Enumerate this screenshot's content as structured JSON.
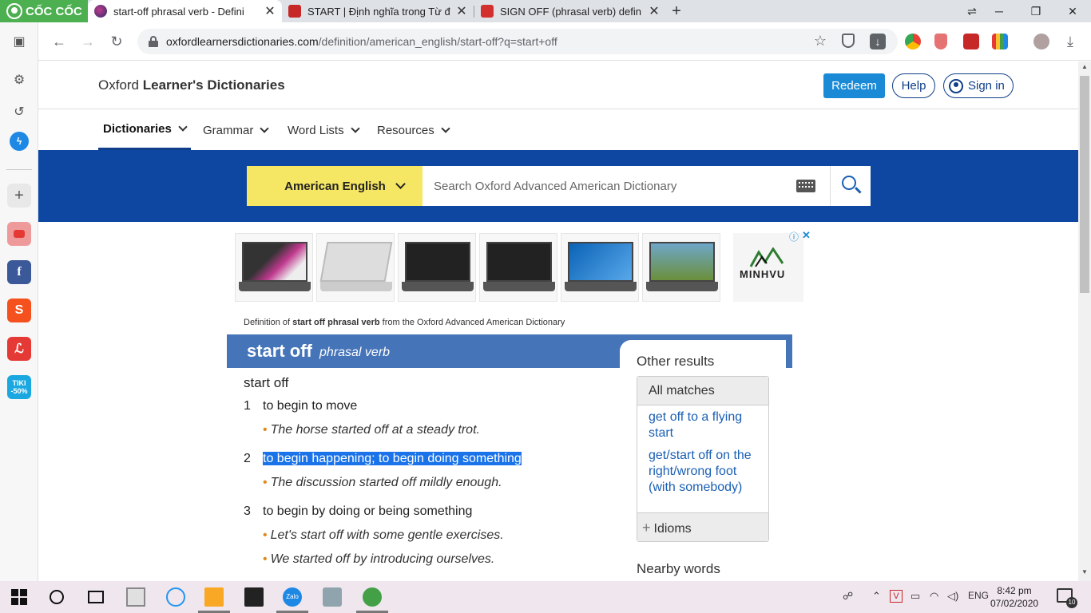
{
  "browser": {
    "brand": "CỐC CỐC",
    "tabs": [
      {
        "title": "start-off phrasal verb - Defini"
      },
      {
        "title": "START | Định nghĩa trong Từ đ"
      },
      {
        "title": "SIGN OFF (phrasal verb) defin"
      }
    ],
    "url_domain": "oxfordlearnersdictionaries.com",
    "url_path": "/definition/american_english/start-off?q=start+off"
  },
  "sidebar": {
    "icons": [
      "panel-icon",
      "gear-icon",
      "history-icon",
      "messenger-icon",
      "add-icon",
      "youtube-icon",
      "facebook-icon",
      "shopee-icon",
      "lazada-icon",
      "tiki-icon"
    ],
    "tiki_label": "TIKI",
    "tiki_badge": "-50%"
  },
  "site": {
    "logo_plain": "Oxford ",
    "logo_bold": "Learner's Dictionaries",
    "redeem": "Redeem",
    "help": "Help",
    "signin": "Sign in",
    "nav": [
      "Dictionaries",
      "Grammar",
      "Word Lists",
      "Resources"
    ]
  },
  "search": {
    "dictionary": "American English",
    "placeholder": "Search Oxford Advanced American Dictionary"
  },
  "ad": {
    "brand": "MINHVU",
    "info": "ⓘ",
    "close": "✕"
  },
  "entry": {
    "source_prefix": "Definition of ",
    "source_bold": "start off phrasal verb",
    "source_suffix": " from the Oxford Advanced American Dictionary",
    "headword": "start off",
    "pos": "phrasal verb",
    "sense_head": "start off",
    "senses": [
      {
        "num": "1",
        "def": "to begin to move",
        "examples": [
          "The horse started off at a steady trot."
        ]
      },
      {
        "num": "2",
        "def": "to begin happening; to begin doing something",
        "examples": [
          "The discussion started off mildly enough."
        ]
      },
      {
        "num": "3",
        "def": "to begin by doing or being something",
        "examples": [
          "Let's start off with some gentle exercises.",
          "We started off by introducing ourselves."
        ]
      }
    ]
  },
  "other_results": {
    "title": "Other results",
    "all_matches": "All matches",
    "links": [
      "get off to a flying start",
      "get/start off on the right/wrong foot (with somebody)"
    ],
    "idioms": "Idioms",
    "nearby": "Nearby words"
  },
  "taskbar": {
    "time": "8:42 pm",
    "date": "07/02/2020",
    "lang": "ENG",
    "notifications": "10",
    "zalo": "Zalo"
  },
  "colors": {
    "oxford_blue": "#0d47a1",
    "entry_blue": "#4574b8",
    "dict_yellow": "#f5e663",
    "link_blue": "#1a5fb4",
    "highlight": "#1a73e8",
    "brand_green": "#4caf50"
  }
}
